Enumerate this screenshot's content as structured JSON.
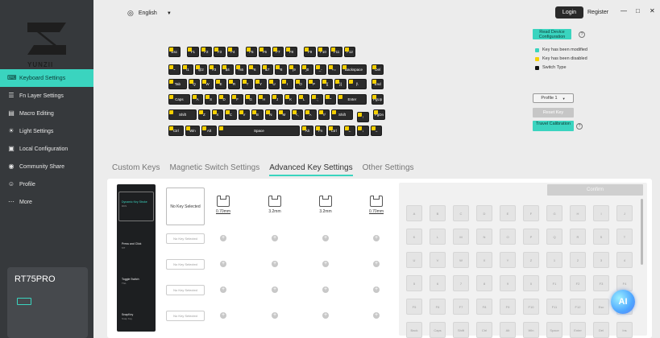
{
  "app": {
    "brand": "YUNZII",
    "language": "English",
    "login": "Login",
    "register": "Register",
    "device": "RT75PRO"
  },
  "nav": [
    {
      "label": "Keyboard Settings",
      "icon": "keyboard-icon",
      "active": true
    },
    {
      "label": "Fn Layer Settings",
      "icon": "layers-icon"
    },
    {
      "label": "Macro Editing",
      "icon": "macro-icon"
    },
    {
      "label": "Light Settings",
      "icon": "light-icon"
    },
    {
      "label": "Local Configuration",
      "icon": "config-icon"
    },
    {
      "label": "Community Share",
      "icon": "share-icon"
    },
    {
      "label": "Profile",
      "icon": "user-icon"
    },
    {
      "label": "More",
      "icon": "more-icon"
    }
  ],
  "right": {
    "read_config": "Read Device Configuration",
    "legend": [
      {
        "label": "Key has been modified",
        "color": "#3ad4bf"
      },
      {
        "label": "Key has been disabled",
        "color": "#f5d000"
      },
      {
        "label": "Switch Type",
        "color": "#111111"
      }
    ],
    "profile": "Profile 1",
    "reset": "Reset Key",
    "travel": "Travel Calibration"
  },
  "tabs": [
    "Custom Keys",
    "Magnetic Switch Settings",
    "Advanced Key Settings",
    "Other Settings"
  ],
  "modes": [
    {
      "title": "Dynamic Key Stroke",
      "sub": "DKS"
    },
    {
      "title": "Press and Click",
      "sub": "MT"
    },
    {
      "title": "Toggle Switch",
      "sub": "TGL"
    },
    {
      "title": "SnapKey",
      "sub": "Snap Key"
    }
  ],
  "no_key": "No Key Selected",
  "strokes": [
    "0.70mm",
    "3.2mm",
    "3.2mm",
    "0.70mm"
  ],
  "confirm": "Confirm",
  "grid": [
    [
      "A",
      "B",
      "C",
      "D",
      "E",
      "F",
      "G",
      "H",
      "I",
      "J"
    ],
    [
      "K",
      "L",
      "M",
      "N",
      "O",
      "P",
      "Q",
      "R",
      "S",
      "T"
    ],
    [
      "U",
      "V",
      "W",
      "X",
      "Y",
      "Z",
      "1",
      "2",
      "3",
      "4"
    ],
    [
      "5",
      "6",
      "7",
      "8",
      "9",
      "0",
      "F1",
      "F2",
      "F3",
      "F4"
    ],
    [
      "F5",
      "F6",
      "F7",
      "F8",
      "F9",
      "F10",
      "F11",
      "F12",
      "Esc",
      "Tab"
    ],
    [
      "Back",
      "Caps",
      "Shift",
      "Ctrl",
      "Alt",
      "Win",
      "Space",
      "Enter",
      "Del",
      "Ins"
    ]
  ],
  "ai": "AI",
  "keyboard": [
    [
      [
        "Esc",
        1
      ],
      [
        "",
        0.4
      ],
      [
        "F1",
        1
      ],
      [
        "F2",
        1
      ],
      [
        "F3",
        1
      ],
      [
        "F4",
        1
      ],
      [
        "",
        0.4
      ],
      [
        "F5",
        1
      ],
      [
        "F6",
        1
      ],
      [
        "F7",
        1
      ],
      [
        "F8",
        1
      ],
      [
        "",
        0.4
      ],
      [
        "F9",
        1
      ],
      [
        "F10",
        1
      ],
      [
        "F11",
        1
      ],
      [
        "F12",
        1
      ]
    ],
    [
      [
        "~",
        1
      ],
      [
        "!1",
        1
      ],
      [
        "@2",
        1
      ],
      [
        "#3",
        1
      ],
      [
        "$4",
        1
      ],
      [
        "%5",
        1
      ],
      [
        "^6",
        1
      ],
      [
        "&7",
        1
      ],
      [
        "*8",
        1
      ],
      [
        "(9",
        1
      ],
      [
        ")0",
        1
      ],
      [
        "_-",
        1
      ],
      [
        "+=",
        1
      ],
      [
        "Backspace",
        2
      ],
      [
        "",
        0.3
      ],
      [
        "Del",
        1
      ]
    ],
    [
      [
        "Tab",
        1.5
      ],
      [
        "Q",
        1
      ],
      [
        "W",
        1
      ],
      [
        "E",
        1
      ],
      [
        "R",
        1
      ],
      [
        "T",
        1
      ],
      [
        "Y",
        1
      ],
      [
        "U",
        1
      ],
      [
        "I",
        1
      ],
      [
        "O",
        1
      ],
      [
        "P",
        1
      ],
      [
        "{[",
        1
      ],
      [
        "}]",
        1
      ],
      [
        "|\\",
        1.5
      ],
      [
        "",
        0.3
      ],
      [
        "End",
        1
      ]
    ],
    [
      [
        "Caps",
        1.75
      ],
      [
        "A",
        1
      ],
      [
        "S",
        1
      ],
      [
        "D",
        1
      ],
      [
        "F",
        1
      ],
      [
        "G",
        1
      ],
      [
        "H",
        1
      ],
      [
        "J",
        1
      ],
      [
        "K",
        1
      ],
      [
        "L",
        1
      ],
      [
        ":;",
        1
      ],
      [
        "\"'",
        1
      ],
      [
        "Enter",
        2.25
      ],
      [
        "",
        0.3
      ],
      [
        "PgUp",
        1
      ]
    ],
    [
      [
        "Shift",
        2.25
      ],
      [
        "Z",
        1
      ],
      [
        "X",
        1
      ],
      [
        "C",
        1
      ],
      [
        "V",
        1
      ],
      [
        "B",
        1
      ],
      [
        "N",
        1
      ],
      [
        "M",
        1
      ],
      [
        "<,",
        1
      ],
      [
        ">.",
        1
      ],
      [
        "?/",
        1
      ],
      [
        "Shift",
        1.75
      ],
      [
        "",
        0.2
      ],
      [
        "↑",
        1
      ],
      [
        "",
        0.2
      ],
      [
        "PgDn",
        1
      ]
    ],
    [
      [
        "Ctrl",
        1.25
      ],
      [
        "Win",
        1.25
      ],
      [
        "Alt",
        1.25
      ],
      [
        "Space",
        6.25
      ],
      [
        "Alt",
        1
      ],
      [
        "Fn",
        1
      ],
      [
        "Ctrl",
        1
      ],
      [
        "",
        0.2
      ],
      [
        "←",
        1
      ],
      [
        "↓",
        1
      ],
      [
        "→",
        1
      ]
    ]
  ]
}
